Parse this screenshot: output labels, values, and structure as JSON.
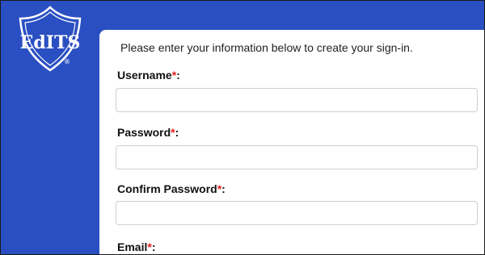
{
  "logo": {
    "text": "EdITS",
    "registered_mark": "®",
    "icon": "edits-logo-icon"
  },
  "form": {
    "intro": "Please enter your information below to create your sign-in.",
    "required_marker": "*",
    "fields": [
      {
        "label": "Username",
        "suffix": ":",
        "value": "",
        "placeholder": ""
      },
      {
        "label": "Password",
        "suffix": ":",
        "value": "",
        "placeholder": ""
      },
      {
        "label": "Confirm Password",
        "suffix": ":",
        "value": "",
        "placeholder": ""
      },
      {
        "label": "Email",
        "suffix": ":"
      }
    ]
  },
  "colors": {
    "band": "#2a4fc2",
    "required": "#e0201b",
    "card": "#ffffff",
    "field_border": "#cfcfcf"
  }
}
